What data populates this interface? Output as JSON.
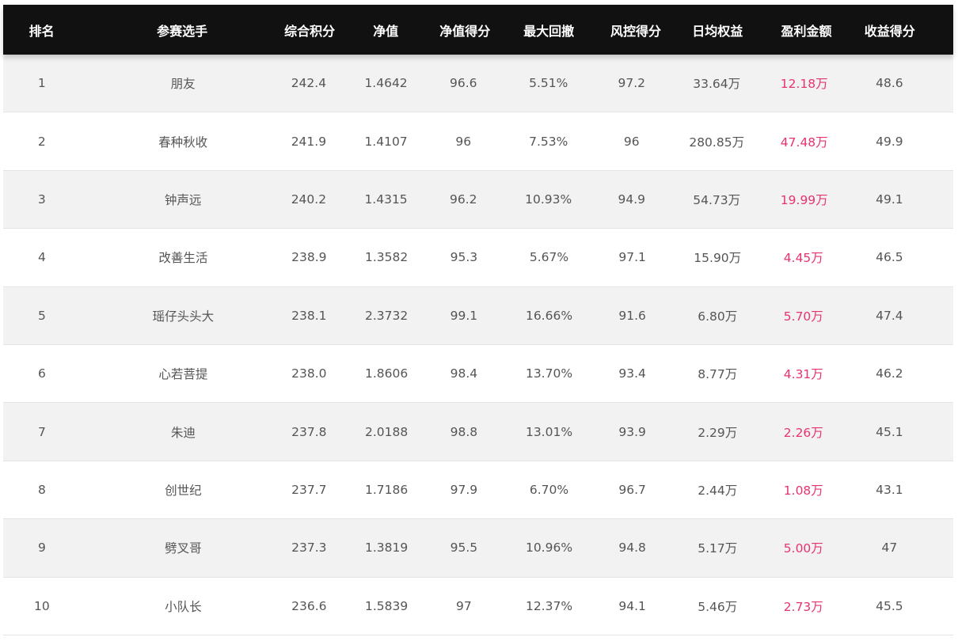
{
  "table": {
    "headers": [
      "排名",
      "参赛选手",
      "综合积分",
      "净值",
      "净值得分",
      "最大回撤",
      "风控得分",
      "日均权益",
      "盈利金额",
      "收益得分"
    ],
    "rows": [
      [
        "1",
        "朋友",
        "242.4",
        "1.4642",
        "96.6",
        "5.51%",
        "97.2",
        "33.64万",
        "12.18万",
        "48.6"
      ],
      [
        "2",
        "春种秋收",
        "241.9",
        "1.4107",
        "96",
        "7.53%",
        "96",
        "280.85万",
        "47.48万",
        "49.9"
      ],
      [
        "3",
        "钟声远",
        "240.2",
        "1.4315",
        "96.2",
        "10.93%",
        "94.9",
        "54.73万",
        "19.99万",
        "49.1"
      ],
      [
        "4",
        "改善生活",
        "238.9",
        "1.3582",
        "95.3",
        "5.67%",
        "97.1",
        "15.90万",
        "4.45万",
        "46.5"
      ],
      [
        "5",
        "瑶仔头头大",
        "238.1",
        "2.3732",
        "99.1",
        "16.66%",
        "91.6",
        "6.80万",
        "5.70万",
        "47.4"
      ],
      [
        "6",
        "心若菩提",
        "238.0",
        "1.8606",
        "98.4",
        "13.70%",
        "93.4",
        "8.77万",
        "4.31万",
        "46.2"
      ],
      [
        "7",
        "朱迪",
        "237.8",
        "2.0188",
        "98.8",
        "13.01%",
        "93.9",
        "2.29万",
        "2.26万",
        "45.1"
      ],
      [
        "8",
        "创世纪",
        "237.7",
        "1.7186",
        "97.9",
        "6.70%",
        "96.7",
        "2.44万",
        "1.08万",
        "43.1"
      ],
      [
        "9",
        "劈叉哥",
        "237.3",
        "1.3819",
        "95.5",
        "10.96%",
        "94.8",
        "5.17万",
        "5.00万",
        "47"
      ],
      [
        "10",
        "小队长",
        "236.6",
        "1.5839",
        "97",
        "12.37%",
        "94.1",
        "5.46万",
        "2.73万",
        "45.5"
      ]
    ]
  },
  "colors": {
    "header_bg": "#111111",
    "header_text": "#ffffff",
    "row_odd_bg": "#f2f2f2",
    "row_even_bg": "#ffffff",
    "text": "#555555",
    "profit_text": "#e8336f"
  }
}
